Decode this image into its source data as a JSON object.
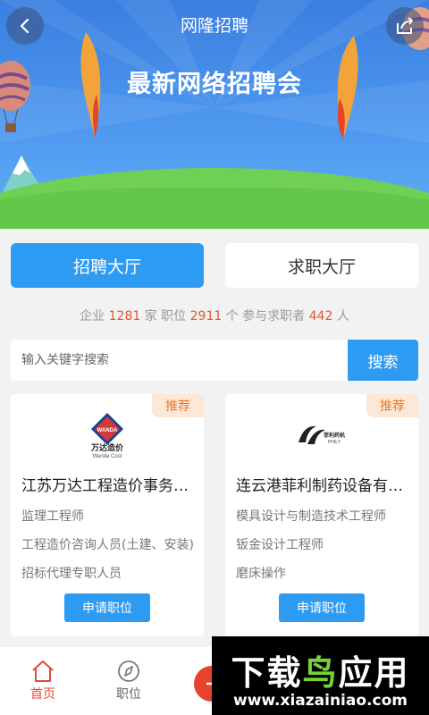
{
  "nav": {
    "title": "网隆招聘",
    "back_icon": "chevron-left-icon",
    "share_icon": "share-icon"
  },
  "banner": {
    "headline": "最新网络招聘会"
  },
  "halls": {
    "recruit_label": "招聘大厅",
    "job_label": "求职大厅"
  },
  "stats": {
    "prefix_company": "企业",
    "company_count": "1281",
    "company_unit": "家",
    "prefix_position": "职位",
    "position_count": "2911",
    "position_unit": "个",
    "prefix_seeker": "参与求职者",
    "seeker_count": "442",
    "seeker_unit": "人"
  },
  "search": {
    "placeholder": "输入关键字搜索",
    "button_label": "搜索"
  },
  "companies": [
    {
      "badge": "推荐",
      "logo_text": "万达造价",
      "logo_sub": "Wanda Cost",
      "logo_mark": "WANDA",
      "name": "江苏万达工程造价事务所有限公司",
      "positions": [
        "监理工程师",
        "工程造价咨询人员(土建、安装)",
        "招标代理专职人员"
      ],
      "apply_label": "申请职位"
    },
    {
      "badge": "推荐",
      "logo_text": "菲利药机",
      "logo_sub": "PHILY",
      "name": "连云港菲利制药设备有限公司",
      "positions": [
        "模具设计与制造技术工程师",
        "钣金设计工程师",
        "磨床操作"
      ],
      "apply_label": "申请职位"
    }
  ],
  "tabbar": {
    "home_label": "首页",
    "jobs_label": "职位"
  },
  "watermark": {
    "title_part1": "下载",
    "title_part2": "鸟",
    "title_part3": "应用",
    "url": "www.xiazainiao.com"
  },
  "colors": {
    "primary": "#2e9bf2",
    "accent": "#e4572e",
    "badge_bg": "#fde7d6",
    "badge_text": "#e67a2e",
    "tab_active": "#e14b3b"
  }
}
